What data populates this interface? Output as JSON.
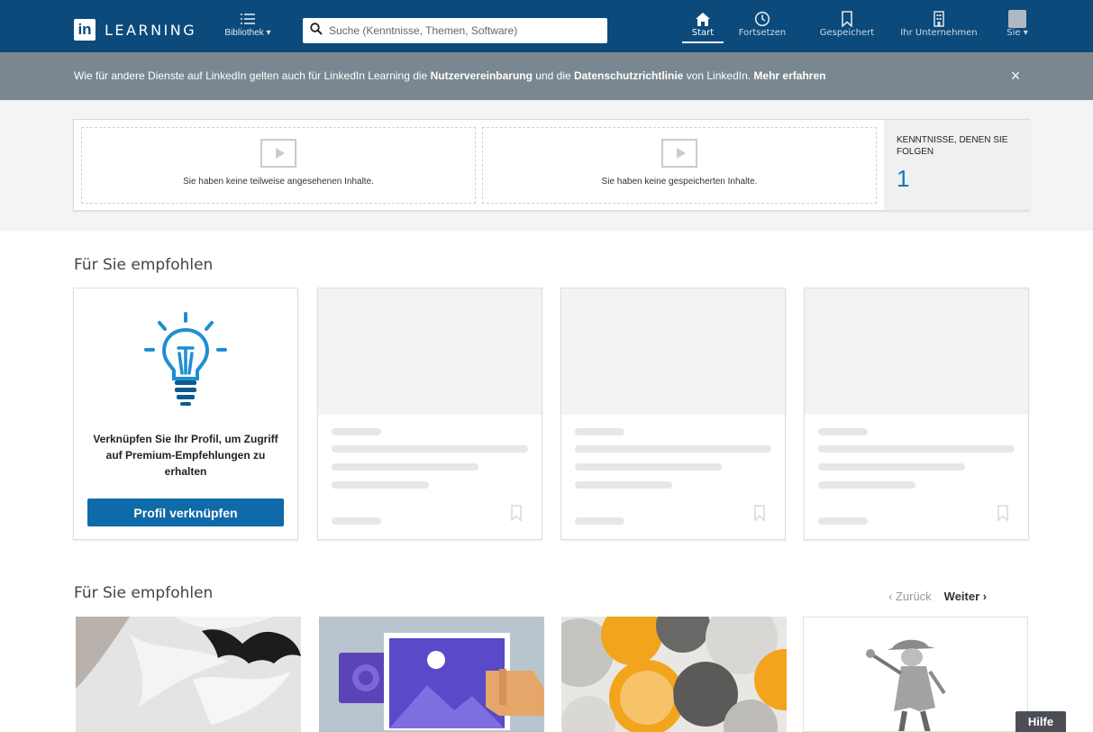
{
  "nav": {
    "brand_in": "in",
    "brand_word": "LEARNING",
    "library_label": "Bibliothek ▾",
    "search_placeholder": "Suche (Kenntnisse, Themen, Software)",
    "items": [
      {
        "label": "Start",
        "icon": "home-icon",
        "active": true
      },
      {
        "label": "Fortsetzen",
        "icon": "clock-icon"
      },
      {
        "label": "Gespeichert",
        "icon": "bookmark-icon"
      },
      {
        "label": "Ihr Unternehmen",
        "icon": "building-icon"
      },
      {
        "label": "Sie ▾",
        "icon": "avatar"
      }
    ]
  },
  "notice": {
    "part1": "Wie für andere Dienste auf LinkedIn gelten auch für LinkedIn Learning die ",
    "link1": "Nutzervereinbarung",
    "part2": " und die ",
    "link2": "Datenschutzrichtlinie",
    "part3": " von LinkedIn. ",
    "more": "Mehr erfahren",
    "close": "×"
  },
  "continue": {
    "slot1_text": "Sie haben keine teilweise angesehenen Inhalte.",
    "slot2_text": "Sie haben keine gespeicherten Inhalte.",
    "skills_label": "KENNTNISSE, DENEN SIE FOLGEN",
    "skills_count": "1"
  },
  "recommended": {
    "title": "Für Sie empfohlen",
    "promo_text": "Verknüpfen Sie Ihr Profil, um Zugriff auf Premium-Empfehlungen zu erhalten",
    "promo_button": "Profil verknüpfen"
  },
  "recommended2": {
    "title": "Für Sie empfohlen",
    "prev": "‹ Zurück",
    "next": "Weiter ›"
  },
  "help": "Hilfe",
  "colors": {
    "nav_bg": "#0b4a7b",
    "notice_bg": "#7a8790",
    "accent": "#0e6aa8",
    "skills_count": "#1778b8"
  }
}
